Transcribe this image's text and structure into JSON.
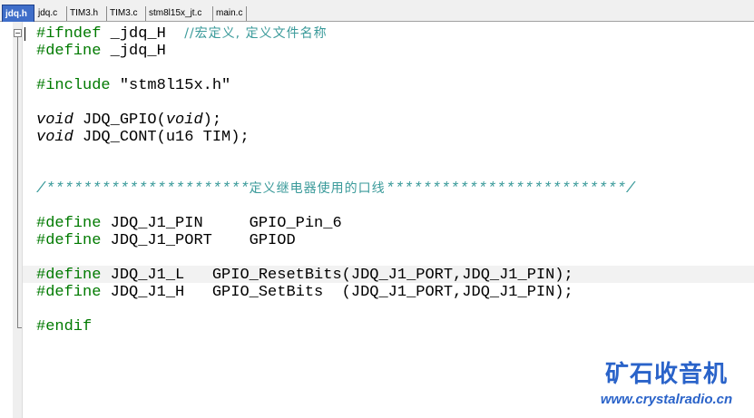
{
  "tabs": [
    {
      "label": "jdq.h",
      "active": true
    },
    {
      "label": "jdq.c",
      "active": false
    },
    {
      "label": "TIM3.h",
      "active": false
    },
    {
      "label": "TIM3.c",
      "active": false
    },
    {
      "label": "stm8l15x_jt.c",
      "active": false
    },
    {
      "label": "main.c",
      "active": false
    }
  ],
  "code": {
    "l1_pp": "#ifndef",
    "l1_rest": " _jdq_H  ",
    "l1_cmt": "//宏定义, 定义文件名称",
    "l2_pp": "#define",
    "l2_rest": " _jdq_H",
    "l4_pp": "#include",
    "l4_str": " \"stm8l15x.h\"",
    "l6_type": "void",
    "l6_mid": " JDQ_GPIO(",
    "l6_type2": "void",
    "l6_end": ");",
    "l7_type": "void",
    "l7_rest": " JDQ_CONT(u16 TIM);",
    "l10_cmt_a": "/**********************",
    "l10_cmt_cn": "定义继电器使用的口线",
    "l10_cmt_b": "**************************/",
    "l12_pp": "#define",
    "l12_rest": " JDQ_J1_PIN     GPIO_Pin_6",
    "l13_pp": "#define",
    "l13_rest": " JDQ_J1_PORT    GPIOD",
    "l15_pp": "#define",
    "l15_rest": " JDQ_J1_L   GPIO_ResetBits(JDQ_J1_PORT,JDQ_J1_PIN);",
    "l16_pp": "#define",
    "l16_rest": " JDQ_J1_H   GPIO_SetBits  (JDQ_J1_PORT,JDQ_J1_PIN);",
    "l18_pp": "#endif"
  },
  "watermark": {
    "title": "矿石收音机",
    "url": "www.crystalradio.cn"
  },
  "colors": {
    "preprocessor": "#007a00",
    "comment": "#3a9a9a",
    "tab_active": "#3f6ec9",
    "watermark": "#2a63c9"
  }
}
